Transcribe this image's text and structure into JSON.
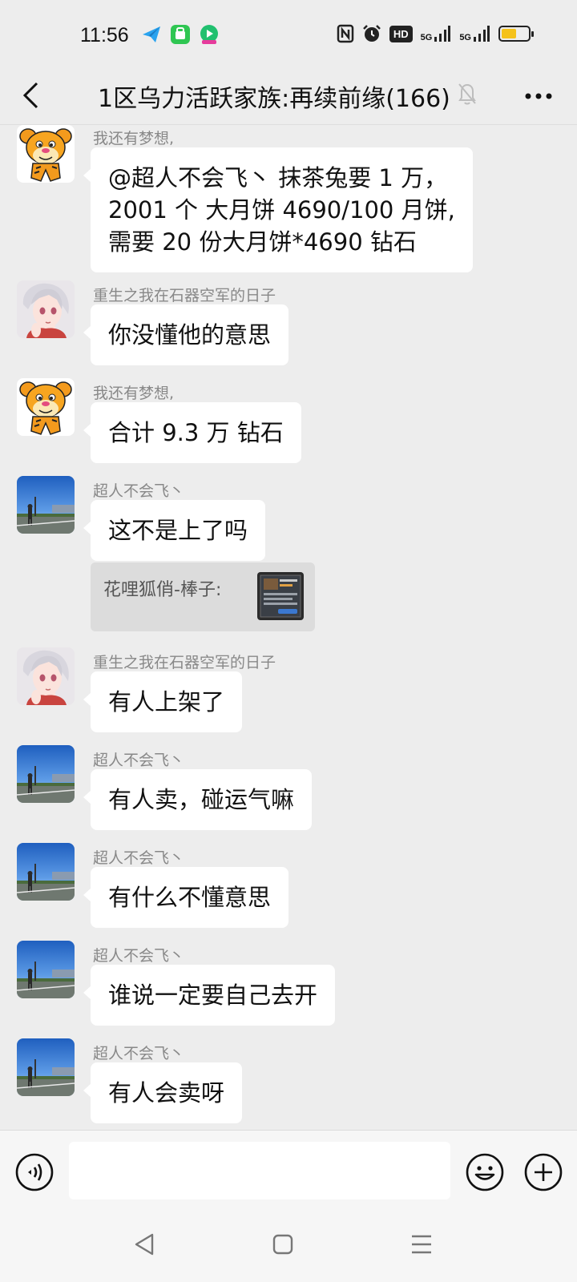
{
  "status_bar": {
    "time": "11:56",
    "network_1": "5G",
    "network_2": "5G",
    "hd_label": "HD",
    "battery_level": 0.55,
    "battery_color": "#f5c21b"
  },
  "header": {
    "back_icon": "chevron-left-icon",
    "title": "1区乌力活跃家族:再续前缘(166)",
    "mute_icon": "bell-off-icon",
    "more_icon": "more-dots-icon"
  },
  "messages": [
    {
      "sender": "我还有梦想,",
      "avatar": "tigger",
      "lines": [
        "@超人不会飞丶  抹茶兔要 1 万，",
        "2001 个 大月饼 4690/100 月饼,",
        "需要 20 份大月饼*4690 钻石"
      ]
    },
    {
      "sender": "重生之我在石器空军的日子",
      "avatar": "anime",
      "lines": [
        "你没懂他的意思"
      ]
    },
    {
      "sender": "我还有梦想,",
      "avatar": "tigger",
      "lines": [
        "合计 9.3 万 钻石"
      ]
    },
    {
      "sender": "超人不会飞丶",
      "avatar": "photo",
      "lines": [
        "这不是上了吗"
      ]
    },
    {
      "sender": "重生之我在石器空军的日子",
      "avatar": "anime",
      "lines": [
        "有人上架了"
      ]
    },
    {
      "sender": "超人不会飞丶",
      "avatar": "photo",
      "lines": [
        "有人卖，碰运气嘛"
      ]
    },
    {
      "sender": "超人不会飞丶",
      "avatar": "photo",
      "lines": [
        "有什么不懂意思"
      ]
    },
    {
      "sender": "超人不会飞丶",
      "avatar": "photo",
      "lines": [
        "谁说一定要自己去开"
      ]
    },
    {
      "sender": "超人不会飞丶",
      "avatar": "photo",
      "lines": [
        "有人会卖呀"
      ]
    }
  ],
  "quote": {
    "text": "花哩狐俏-棒子:",
    "thumbnail": "game-screenshot-thumbnail"
  },
  "input_bar": {
    "voice_icon": "voice-icon",
    "input_value": "",
    "emoji_icon": "emoji-icon",
    "plus_icon": "plus-circle-icon"
  },
  "nav_bar": {
    "back_icon": "nav-back-icon",
    "home_icon": "nav-home-icon",
    "menu_icon": "nav-menu-icon"
  }
}
